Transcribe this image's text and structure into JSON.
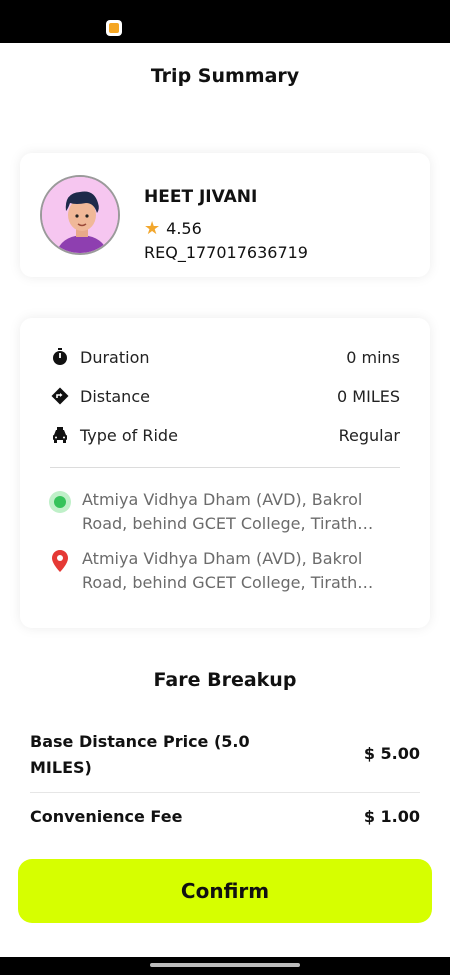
{
  "page": {
    "title": "Trip Summary"
  },
  "driver": {
    "name": "HEET JIVANI",
    "rating": "4.56",
    "request_id": "REQ_177017636719"
  },
  "trip": {
    "rows": [
      {
        "label": "Duration",
        "value": "0 mins",
        "icon": "stopwatch-icon"
      },
      {
        "label": "Distance",
        "value": "0 MILES",
        "icon": "direction-sign-icon"
      },
      {
        "label": "Type of Ride",
        "value": "Regular",
        "icon": "taxi-icon"
      }
    ],
    "pickup": "Atmiya Vidhya Dham (AVD), Bakrol Road, behind GCET College, Tirath…",
    "dropoff": "Atmiya Vidhya Dham (AVD), Bakrol Road, behind GCET College, Tirath…"
  },
  "fare": {
    "title": "Fare Breakup",
    "items": [
      {
        "label": "Base Distance Price (5.0 MILES)",
        "value": "$ 5.00"
      },
      {
        "label": "Convenience Fee",
        "value": "$ 1.00"
      }
    ]
  },
  "actions": {
    "confirm_label": "Confirm"
  },
  "colors": {
    "accent": "#d6ff00",
    "pickup_pin": "#35c35a",
    "dropoff_pin": "#e53935",
    "star": "#f2a72d"
  }
}
